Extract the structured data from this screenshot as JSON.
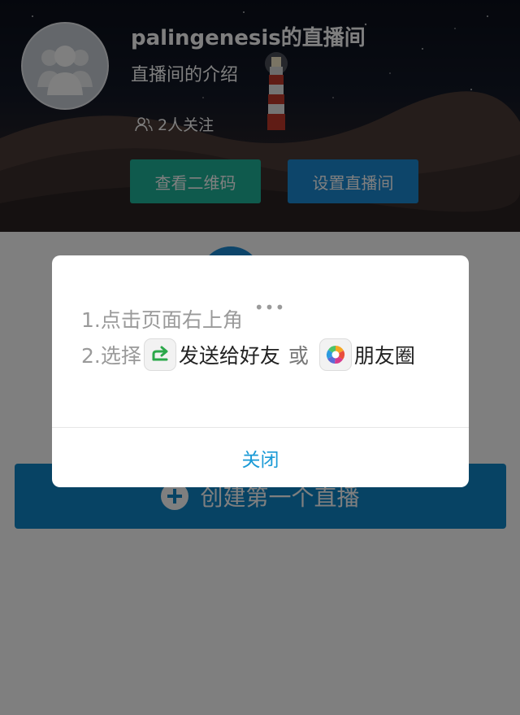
{
  "header": {
    "room_title": "palingenesis的直播间",
    "room_description": "直播间的介绍",
    "followers": "2人关注",
    "qr_button": "查看二维码",
    "settings_button": "设置直播间"
  },
  "main": {
    "create_button": "创建第一个直播"
  },
  "dialog": {
    "step1": "1.点击页面右上角",
    "step1_dots": "•••",
    "step2_prefix": "2.选择",
    "send_to_friend": "发送给好友",
    "or": "或",
    "moments": "朋友圈",
    "close": "关闭"
  },
  "icons": {
    "share": "share-icon",
    "moments": "moments-icon",
    "avatar": "avatar-icon",
    "followers": "followers-icon"
  },
  "colors": {
    "qr_button": "#1fb49a",
    "settings_button": "#1a8ad4",
    "create_button": "#0f86c9",
    "close_text": "#1a9ad6"
  }
}
